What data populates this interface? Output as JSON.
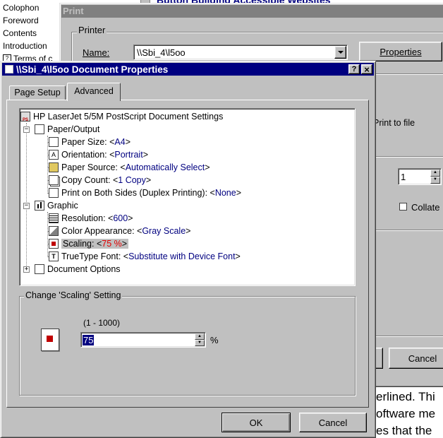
{
  "help_window": {
    "toc": [
      "Colophon",
      "Foreword",
      "Contents",
      "Introduction",
      "Terms of c"
    ],
    "heading_fragment": "Button Building Accessible Websites",
    "body_lines": [
      "erlined. Thi",
      "oftware me",
      "es that the"
    ]
  },
  "print_dialog": {
    "title": "Print",
    "printer_group": "Printer",
    "name_label": "Name:",
    "name_value": "\\\\Sbi_4\\l5oo",
    "properties_button": "Properties",
    "print_to_file": "Print to file",
    "copies_value": "1",
    "collate_label": "Collate",
    "cancel_button": "Cancel"
  },
  "properties_dialog": {
    "title": "\\\\Sbi_4\\l5oo Document Properties",
    "help_button": "?",
    "close_button": "×",
    "tabs": [
      {
        "label": "Page Setup",
        "active": false
      },
      {
        "label": "Advanced",
        "active": true
      }
    ],
    "tree": {
      "root": "HP LaserJet 5/5M PostScript Document Settings",
      "paper_output": "Paper/Output",
      "paper_size_label": "Paper Size: <",
      "paper_size_value": "A4",
      "orientation_label": "Orientation: <",
      "orientation_value": "Portrait",
      "paper_source_label": "Paper Source: <",
      "paper_source_value": "Automatically Select",
      "copy_count_label": "Copy Count: <",
      "copy_count_value": "1 Copy",
      "duplex_label": "Print on Both Sides (Duplex Printing): <",
      "duplex_value": "None",
      "graphic": "Graphic",
      "resolution_label": "Resolution: <",
      "resolution_value": "600",
      "color_label": "Color Appearance: <",
      "color_value": "Gray Scale",
      "scaling_label": "Scaling: <",
      "scaling_value": "75 %",
      "truetype_label": "TrueType Font: <",
      "truetype_value": "Substitute with Device Font",
      "document_options": "Document Options",
      "close_bracket": ">"
    },
    "change_group": "Change 'Scaling' Setting",
    "range_label": "(1 - 1000)",
    "scaling_input": "75",
    "percent": "%",
    "ok_button": "OK",
    "cancel_button": "Cancel"
  }
}
